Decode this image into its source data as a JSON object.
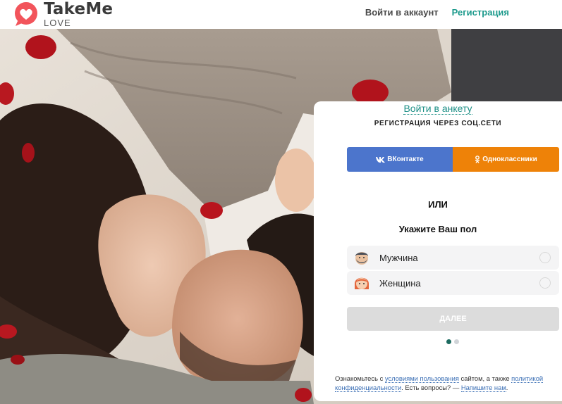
{
  "header": {
    "logo_title": "TakeMe",
    "logo_subtitle": "LOVE",
    "nav_login": "Войти в аккаунт",
    "nav_register": "Регистрация"
  },
  "card": {
    "login_link": "Войти в анкету",
    "social_title": "РЕГИСТРАЦИЯ ЧЕРЕЗ СОЦ.СЕТИ",
    "vk_label": "ВКонтакте",
    "ok_label": "Одноклассники",
    "or_label": "ИЛИ",
    "gender_title": "Укажите Ваш пол",
    "options": [
      {
        "label": "Мужчина",
        "selected": false
      },
      {
        "label": "Женщина",
        "selected": false
      }
    ],
    "next_label": "ДАЛЕЕ",
    "pagination": {
      "current": 1,
      "total": 2
    }
  },
  "footer": {
    "t1": "Ознакомьтесь с ",
    "link_terms": "условиями пользования",
    "t2": " сайтом, а также ",
    "link_policy": "политикой конфиденциальности",
    "t3": ". Есть вопросы? — ",
    "link_contact": "Напишите нам",
    "t4": "."
  },
  "colors": {
    "accent": "#1c9a8c",
    "vk": "#4c75cc",
    "ok": "#ee8208",
    "logo": "#f2545b",
    "button_disabled": "#dcdcdc"
  },
  "icons": {
    "logo": "heart-chat-icon",
    "vk": "vk-icon",
    "ok": "odnoklassniki-icon",
    "male": "male-avatar-icon",
    "female": "female-avatar-icon"
  }
}
